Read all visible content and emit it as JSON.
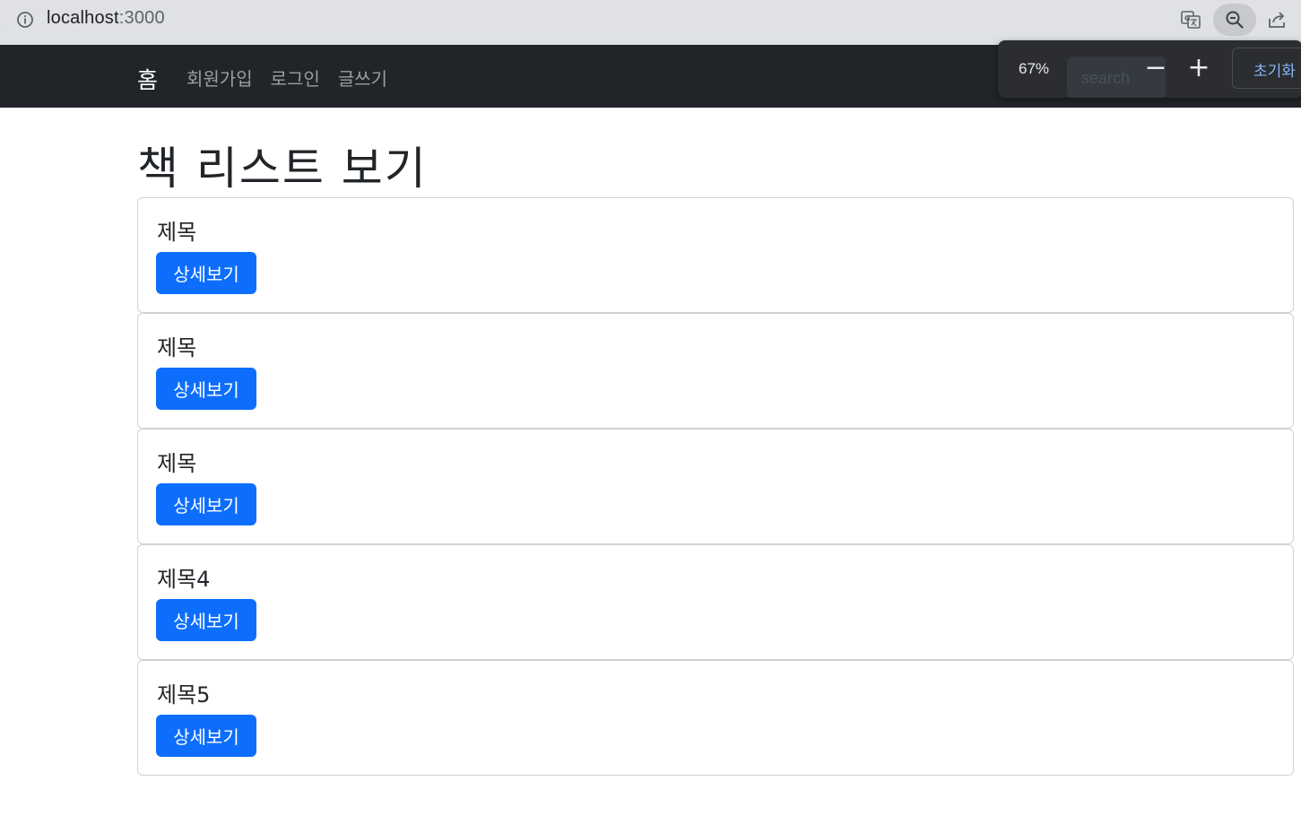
{
  "browser": {
    "url_host": "localhost",
    "url_port": ":3000",
    "icons": [
      "info-icon",
      "translate-icon",
      "zoom-icon",
      "share-icon"
    ]
  },
  "navbar": {
    "brand": "홈",
    "links": [
      {
        "label": "회원가입"
      },
      {
        "label": "로그인"
      },
      {
        "label": "글쓰기"
      }
    ]
  },
  "zoom_popup": {
    "level": "67%",
    "search_placeholder": "search",
    "minus": "−",
    "plus": "+",
    "reset_label": "초기화"
  },
  "main": {
    "title": "책 리스트 보기",
    "books": [
      {
        "title": "제목",
        "button": "상세보기"
      },
      {
        "title": "제목",
        "button": "상세보기"
      },
      {
        "title": "제목",
        "button": "상세보기"
      },
      {
        "title": "제목4",
        "button": "상세보기"
      },
      {
        "title": "제목5",
        "button": "상세보기"
      }
    ]
  },
  "colors": {
    "navbar_bg": "#212529",
    "primary": "#0d6efd",
    "link_accent": "#8ab4f8"
  }
}
